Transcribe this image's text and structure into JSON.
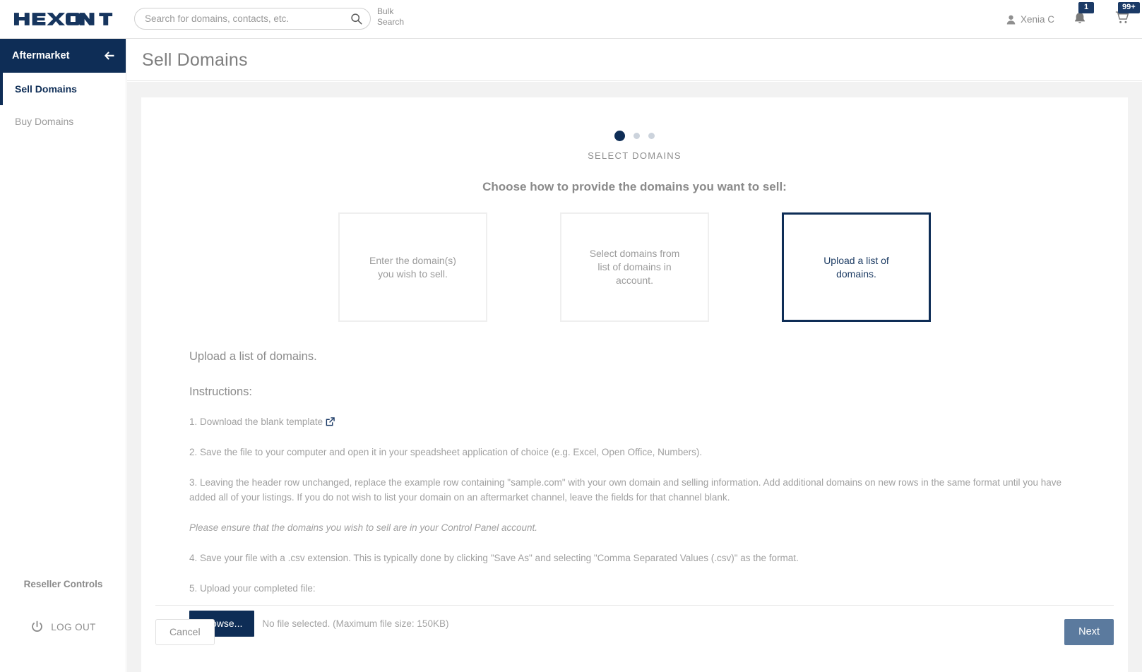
{
  "header": {
    "logo_text": "HEXONET",
    "search": {
      "placeholder": "Search for domains, contacts, etc.",
      "value": "",
      "icon": "search-icon"
    },
    "bulk_search_label": "Bulk\nSearch",
    "bulk_search_line1": "Bulk",
    "bulk_search_line2": "Search",
    "user": {
      "name": "Xenia C",
      "icon": "user-icon"
    },
    "notifications": {
      "icon": "bell-icon",
      "badge": "1"
    },
    "cart": {
      "icon": "cart-icon",
      "badge": "99+"
    }
  },
  "sidebar": {
    "title": "Aftermarket",
    "collapse_icon": "arrow-left-icon",
    "items": [
      {
        "label": "Sell Domains",
        "active": true
      },
      {
        "label": "Buy Domains",
        "active": false
      }
    ],
    "reseller_controls_label": "Reseller Controls",
    "logout_label": "LOG OUT",
    "logout_icon": "power-icon"
  },
  "page": {
    "title": "Sell Domains"
  },
  "wizard": {
    "steps_total": 3,
    "current_step": 1,
    "step_label": "SELECT DOMAINS",
    "choose_heading": "Choose how to provide the domains you want to sell:",
    "options": [
      {
        "text": "Enter the domain(s) you wish to sell.",
        "selected": false
      },
      {
        "text": "Select domains from list of domains in account.",
        "selected": false
      },
      {
        "text": "Upload a list of domains.",
        "selected": true
      }
    ]
  },
  "upload_panel": {
    "title": "Upload a list of domains.",
    "instructions_label": "Instructions:",
    "steps": [
      {
        "text": "1. Download the blank template",
        "link_icon": "external-link-icon",
        "italic": false
      },
      {
        "text": "2. Save the file to your computer and open it in your speadsheet application of choice (e.g. Excel, Open Office, Numbers).",
        "italic": false
      },
      {
        "text": "3. Leaving the header row unchanged, replace the example row containing \"sample.com\" with your own domain and selling information. Add additional domains on new rows in the same format until you have added all of your listings. If you do not wish to list your domain on an aftermarket channel, leave the fields for that channel blank.",
        "italic": false
      },
      {
        "text": "Please ensure that the domains you wish to sell are in your Control Panel account.",
        "italic": true
      },
      {
        "text": "4. Save your file with a .csv extension. This is typically done by clicking \"Save As\" and selecting \"Comma Separated Values (.csv)\" as the format.",
        "italic": false
      },
      {
        "text": "5. Upload your completed file:",
        "italic": false
      }
    ],
    "browse_button_label": "Browse...",
    "file_status": "No file selected. (Maximum file size: 150KB)"
  },
  "footer": {
    "cancel_label": "Cancel",
    "next_label": "Next"
  },
  "colors": {
    "brand_navy": "#0e2d56",
    "badge_navy": "#1b3a66",
    "next_button": "#5b7a9e",
    "page_background": "#f2f2f2",
    "muted_text": "#9b9b9b"
  }
}
